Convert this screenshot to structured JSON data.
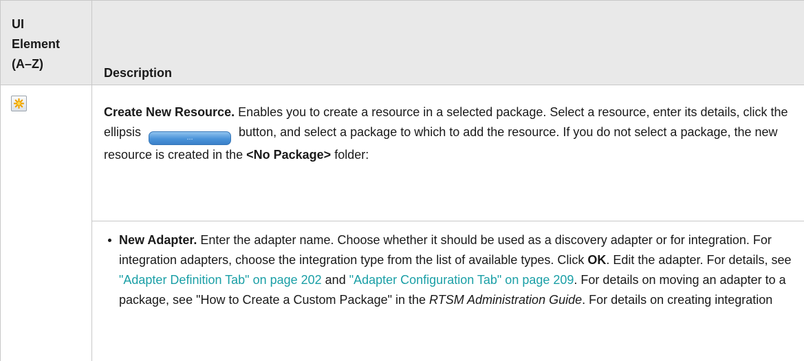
{
  "header": {
    "col1": "UI\nElement\n(A–Z)",
    "col2": "Description"
  },
  "row": {
    "icon": "create-new-resource-icon",
    "title": "Create New Resource.",
    "text_1": " Enables you to create a resource in a selected package. Select a resource, enter its details, click the ellipsis ",
    "ellipsis_label": "...",
    "text_2": " button, and select a package to which to add the resource. If you do not select a package, the new resource is created in the ",
    "no_package": "<No Package>",
    "text_3": " folder:"
  },
  "bullet": {
    "title": "New Adapter.",
    "text_1": " Enter the adapter name. Choose whether it should be used as a discovery adapter or for integration. For integration adapters, choose the integration type from the list of available types. Click ",
    "ok": "OK",
    "text_2": ". Edit the adapter. For details, see ",
    "link_1": "\"Adapter Definition Tab\" on page 202",
    "text_3": " and ",
    "link_2": "\"Adapter Configuration Tab\" on page 209",
    "text_4": ". For details on moving an adapter to a package, see \"How to Create a Custom Package\" in the ",
    "guide": "RTSM Administration Guide",
    "text_5": ". For details on creating integration"
  },
  "colors": {
    "header_bg": "#e9e9e9",
    "border": "#c8c8c8",
    "link": "#1a9fa6",
    "button_blue": "#4a93d9"
  }
}
